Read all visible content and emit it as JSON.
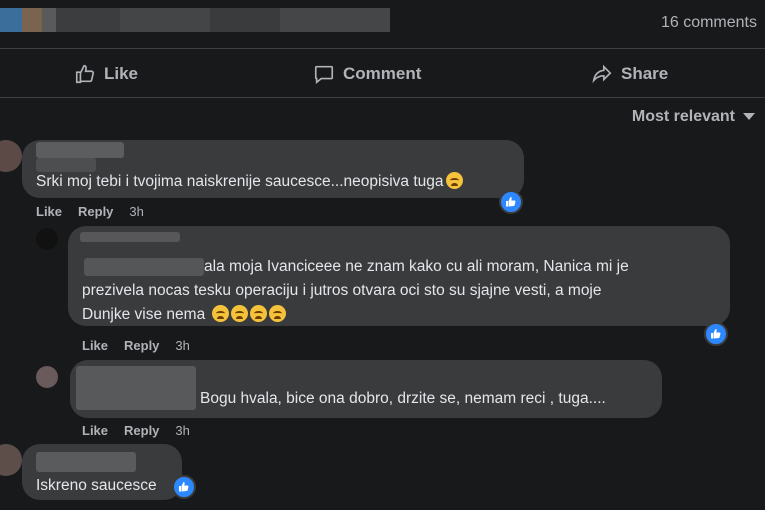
{
  "header": {
    "comments_count": "16 comments"
  },
  "actions": {
    "like": "Like",
    "comment": "Comment",
    "share": "Share"
  },
  "sort": {
    "label": "Most relevant"
  },
  "comments": [
    {
      "text": "Srki moj tebi i tvojima naiskrenije saucesce...neopisiva tuga",
      "emoji": "sad-face",
      "like_label": "Like",
      "reply_label": "Reply",
      "time": "3h",
      "reaction": "like-reaction"
    },
    {
      "author": "Brajan Jerdatic",
      "line1": "ala moja Ivanciceee ne znam kako cu ali moram, Nanica mi je",
      "line2": "prezivela nocas tesku operaciju i jutros otvara oci sto su sjajne vesti, a moje",
      "line3": "Dunjke vise nema",
      "emojis": "crying-face x4",
      "like_label": "Like",
      "reply_label": "Reply",
      "time": "3h",
      "reaction": "like-reaction"
    },
    {
      "text": "Bogu hvala, bice ona dobro, drzite se, nemam reci , tuga....",
      "like_label": "Like",
      "reply_label": "Reply",
      "time": "3h"
    },
    {
      "text": "Iskreno saucesce",
      "reaction": "like-reaction"
    }
  ],
  "colors": {
    "background": "#18191a",
    "bubble": "#3a3b3c",
    "text": "#e4e6eb",
    "secondary_text": "#b0b3b8",
    "like_blue": "#2d88ff"
  }
}
